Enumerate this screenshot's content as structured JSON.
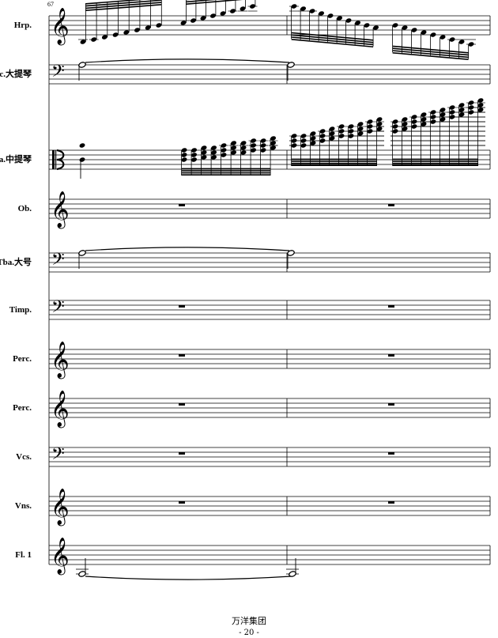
{
  "score": {
    "measure_number": "67",
    "instruments": [
      {
        "label": "Hrp.",
        "clef": "treble"
      },
      {
        "label": "Vc.大提琴",
        "clef": "bass"
      },
      {
        "label": "Va.中提琴",
        "clef": "alto"
      },
      {
        "label": "Ob.",
        "clef": "treble"
      },
      {
        "label": "Tba.大号",
        "clef": "bass"
      },
      {
        "label": "Timp.",
        "clef": "bass"
      },
      {
        "label": "Perc.",
        "clef": "treble"
      },
      {
        "label": "Perc.",
        "clef": "treble"
      },
      {
        "label": "Vcs.",
        "clef": "bass"
      },
      {
        "label": "Vns.",
        "clef": "treble"
      },
      {
        "label": "Fl. 1",
        "clef": "treble"
      }
    ]
  },
  "footer": {
    "publisher": "万洋集团",
    "page": "- 20 -"
  }
}
